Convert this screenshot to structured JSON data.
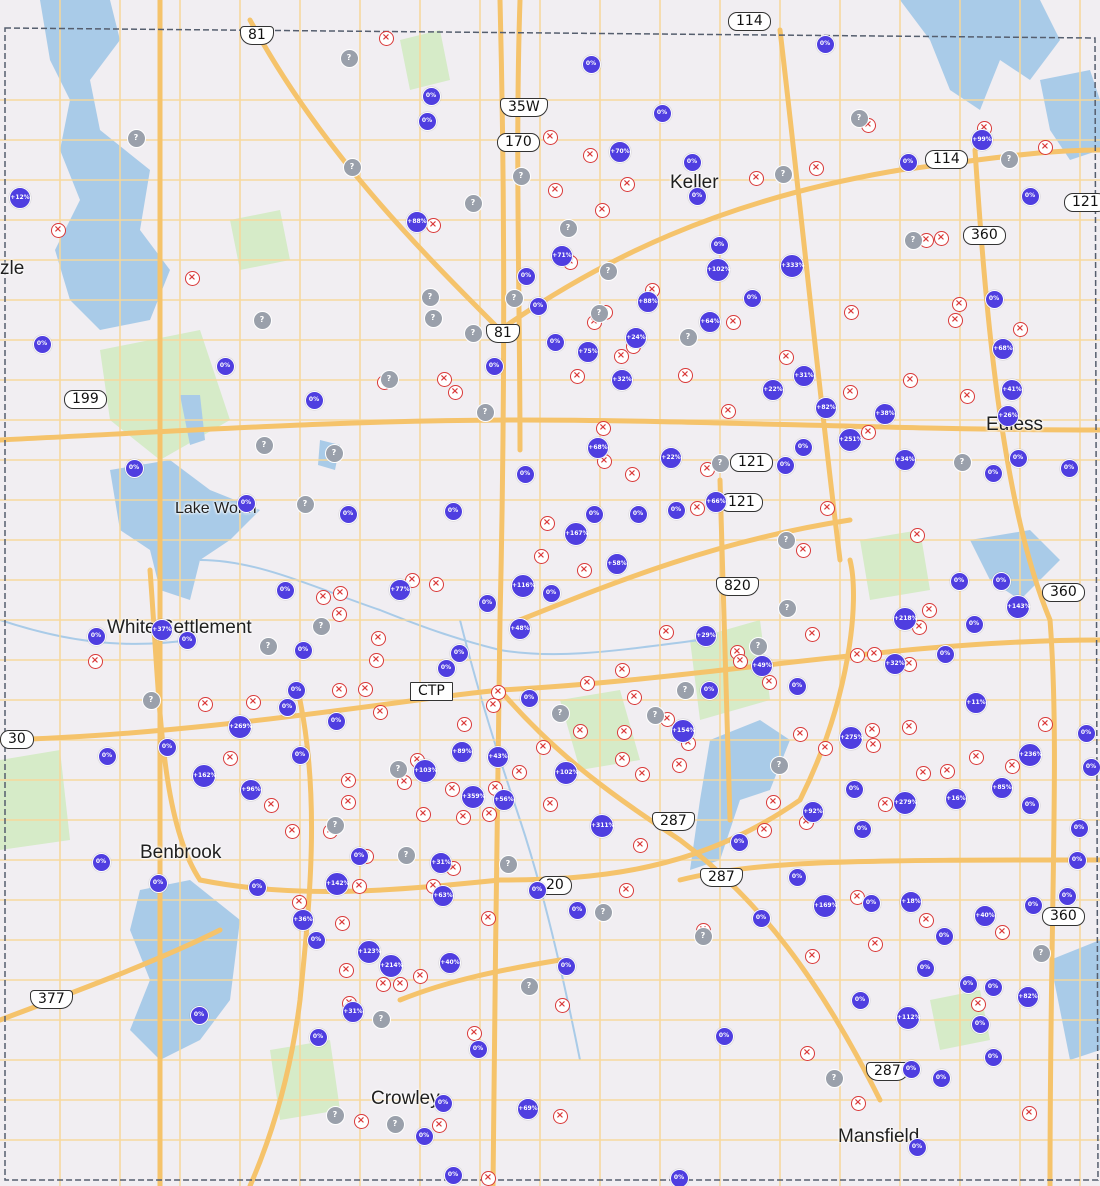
{
  "map": {
    "colors": {
      "land": "#f1eef2",
      "water": "#a9cbe8",
      "park": "#d6ebc8",
      "highway": "#f5c36b",
      "road": "#f7d79a",
      "boundary": "#555e6e",
      "marker_up": "#4f3ee0",
      "marker_unknown": "#9aa0ab",
      "marker_none": "#d93838"
    }
  },
  "places": [
    "Keller",
    "Euless",
    "Lake Worth",
    "White Settlement",
    "Benbrook",
    "Crowley",
    "Mansfield",
    "zle"
  ],
  "shields": [
    "81",
    "114",
    "35W",
    "170",
    "114",
    "121",
    "360",
    "81",
    "199",
    "121",
    "121",
    "820",
    "360",
    "CTP",
    "287",
    "287",
    "20",
    "360",
    "377",
    "287",
    "30"
  ],
  "marker_values": {
    "up": [
      "+12%",
      "+88%",
      "+70%",
      "+71%",
      "+102%",
      "+333%",
      "+88%",
      "+64%",
      "+24%",
      "+75%",
      "+32%",
      "+99%",
      "+68%",
      "+41%",
      "+26%",
      "+22%",
      "+31%",
      "+82%",
      "+38%",
      "+251%",
      "+34%",
      "+68%",
      "+22%",
      "+66%",
      "+167%",
      "+58%",
      "+116%",
      "+77%",
      "+48%",
      "+37%",
      "+218%",
      "+143%",
      "+29%",
      "+49%",
      "+32%",
      "+269%",
      "+11%",
      "+154%",
      "+275%",
      "+236%",
      "+89%",
      "+43%",
      "+103%",
      "+162%",
      "+96%",
      "+102%",
      "+359%",
      "+56%",
      "+279%",
      "+16%",
      "+85%",
      "+92%",
      "+311%",
      "+142%",
      "+31%",
      "+63%",
      "+36%",
      "+169%",
      "+18%",
      "+40%",
      "+123%",
      "+214%",
      "+40%",
      "+82%",
      "+31%",
      "+112%",
      "+69%"
    ],
    "zero": "0%",
    "unknown": "?",
    "none": "×"
  }
}
